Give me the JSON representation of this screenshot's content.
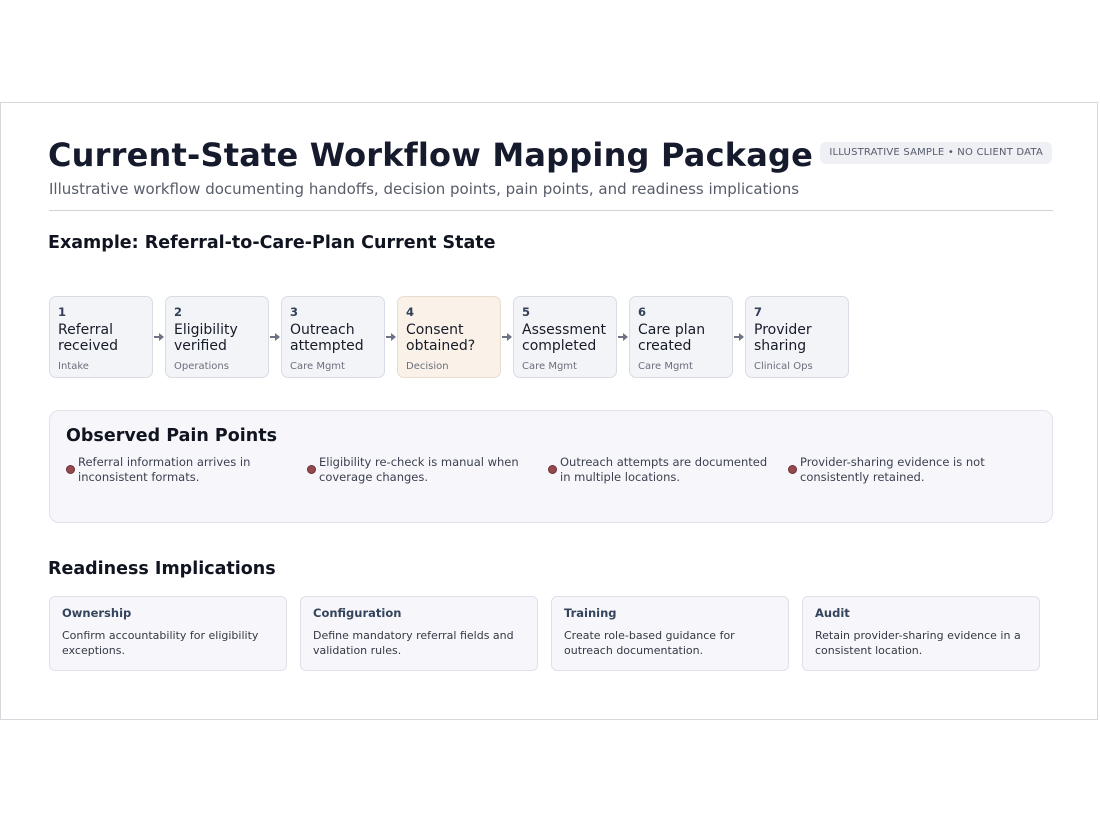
{
  "header": {
    "title": "Current-State Workflow Mapping Package",
    "badge": "ILLUSTRATIVE SAMPLE • NO CLIENT DATA",
    "subtitle": "Illustrative workflow documenting handoffs, decision points, pain points, and readiness implications"
  },
  "workflow": {
    "heading": "Example: Referral-to-Care-Plan Current State",
    "steps": [
      {
        "num": "1",
        "label": "Referral\nreceived",
        "role": "Intake",
        "decision": false
      },
      {
        "num": "2",
        "label": "Eligibility\nverified",
        "role": "Operations",
        "decision": false
      },
      {
        "num": "3",
        "label": "Outreach\nattempted",
        "role": "Care Mgmt",
        "decision": false
      },
      {
        "num": "4",
        "label": "Consent\nobtained?",
        "role": "Decision",
        "decision": true
      },
      {
        "num": "5",
        "label": "Assessment\ncompleted",
        "role": "Care Mgmt",
        "decision": false
      },
      {
        "num": "6",
        "label": "Care plan\ncreated",
        "role": "Care Mgmt",
        "decision": false
      },
      {
        "num": "7",
        "label": "Provider\nsharing",
        "role": "Clinical Ops",
        "decision": false
      }
    ]
  },
  "pain_points": {
    "heading": "Observed Pain Points",
    "items": [
      "Referral information arrives in inconsistent formats.",
      "Eligibility re-check is manual when coverage changes.",
      "Outreach attempts are documented in multiple locations.",
      "Provider-sharing evidence is not consistently retained."
    ],
    "dot_color": "#934a4f"
  },
  "readiness": {
    "heading": "Readiness Implications",
    "cards": [
      {
        "title": "Ownership",
        "text": "Confirm accountability for eligibility exceptions."
      },
      {
        "title": "Configuration",
        "text": "Define mandatory referral fields and validation rules."
      },
      {
        "title": "Training",
        "text": "Create role-based guidance for outreach documentation."
      },
      {
        "title": "Audit",
        "text": "Retain provider-sharing evidence in a consistent location."
      }
    ]
  },
  "colors": {
    "step_fill": "#f3f4f8",
    "decision_fill": "#faf2e8",
    "title": "#151a2c",
    "accent": "#34445d"
  }
}
